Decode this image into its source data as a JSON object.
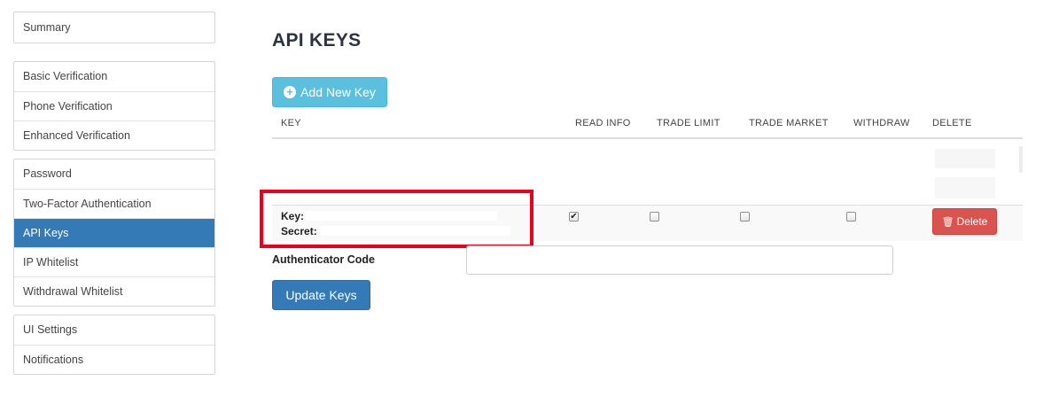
{
  "sidebar": {
    "groups": [
      {
        "items": [
          {
            "label": "Summary"
          }
        ]
      },
      {
        "items": [
          {
            "label": "Basic Verification"
          },
          {
            "label": "Phone Verification"
          },
          {
            "label": "Enhanced Verification"
          }
        ]
      },
      {
        "items": [
          {
            "label": "Password"
          },
          {
            "label": "Two-Factor Authentication"
          },
          {
            "label": "API Keys",
            "active": true
          },
          {
            "label": "IP Whitelist"
          },
          {
            "label": "Withdrawal Whitelist"
          }
        ]
      },
      {
        "items": [
          {
            "label": "UI Settings"
          },
          {
            "label": "Notifications"
          }
        ]
      }
    ]
  },
  "main": {
    "title": "API KEYS",
    "add_button": {
      "label": "Add New Key",
      "icon": "plus-circle-icon"
    },
    "table": {
      "headers": [
        "KEY",
        "READ INFO",
        "TRADE LIMIT",
        "TRADE MARKET",
        "WITHDRAW",
        "DELETE"
      ],
      "rows": [
        {
          "key_label": "Key:",
          "secret_label": "Secret:",
          "permissions": {
            "read_info": true,
            "trade_limit": false,
            "trade_market": false,
            "withdraw": false
          },
          "delete_label": "Delete",
          "delete_icon": "trash-icon"
        }
      ]
    },
    "auth": {
      "label": "Authenticator Code",
      "value": "",
      "placeholder": ""
    },
    "update_button": {
      "label": "Update Keys"
    }
  },
  "colors": {
    "active_item": "#337ab7",
    "add_button": "#5bc0de",
    "delete_button": "#d9534f",
    "update_button": "#337ab7",
    "highlight_box": "#e8001c"
  }
}
